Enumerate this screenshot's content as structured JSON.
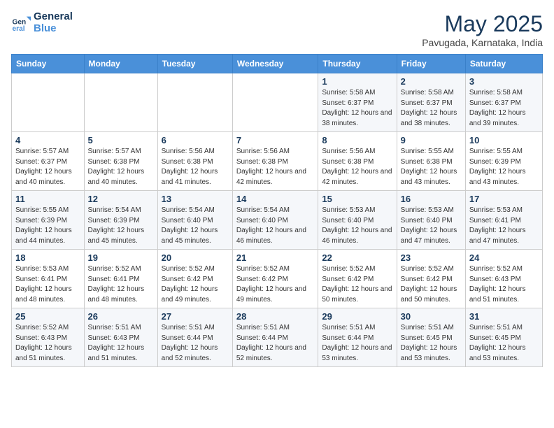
{
  "header": {
    "logo_line1": "General",
    "logo_line2": "Blue",
    "month": "May 2025",
    "location": "Pavugada, Karnataka, India"
  },
  "days_of_week": [
    "Sunday",
    "Monday",
    "Tuesday",
    "Wednesday",
    "Thursday",
    "Friday",
    "Saturday"
  ],
  "weeks": [
    [
      {
        "day": "",
        "info": ""
      },
      {
        "day": "",
        "info": ""
      },
      {
        "day": "",
        "info": ""
      },
      {
        "day": "",
        "info": ""
      },
      {
        "day": "1",
        "info": "Sunrise: 5:58 AM\nSunset: 6:37 PM\nDaylight: 12 hours\nand 38 minutes."
      },
      {
        "day": "2",
        "info": "Sunrise: 5:58 AM\nSunset: 6:37 PM\nDaylight: 12 hours\nand 38 minutes."
      },
      {
        "day": "3",
        "info": "Sunrise: 5:58 AM\nSunset: 6:37 PM\nDaylight: 12 hours\nand 39 minutes."
      }
    ],
    [
      {
        "day": "4",
        "info": "Sunrise: 5:57 AM\nSunset: 6:37 PM\nDaylight: 12 hours\nand 40 minutes."
      },
      {
        "day": "5",
        "info": "Sunrise: 5:57 AM\nSunset: 6:38 PM\nDaylight: 12 hours\nand 40 minutes."
      },
      {
        "day": "6",
        "info": "Sunrise: 5:56 AM\nSunset: 6:38 PM\nDaylight: 12 hours\nand 41 minutes."
      },
      {
        "day": "7",
        "info": "Sunrise: 5:56 AM\nSunset: 6:38 PM\nDaylight: 12 hours\nand 42 minutes."
      },
      {
        "day": "8",
        "info": "Sunrise: 5:56 AM\nSunset: 6:38 PM\nDaylight: 12 hours\nand 42 minutes."
      },
      {
        "day": "9",
        "info": "Sunrise: 5:55 AM\nSunset: 6:38 PM\nDaylight: 12 hours\nand 43 minutes."
      },
      {
        "day": "10",
        "info": "Sunrise: 5:55 AM\nSunset: 6:39 PM\nDaylight: 12 hours\nand 43 minutes."
      }
    ],
    [
      {
        "day": "11",
        "info": "Sunrise: 5:55 AM\nSunset: 6:39 PM\nDaylight: 12 hours\nand 44 minutes."
      },
      {
        "day": "12",
        "info": "Sunrise: 5:54 AM\nSunset: 6:39 PM\nDaylight: 12 hours\nand 45 minutes."
      },
      {
        "day": "13",
        "info": "Sunrise: 5:54 AM\nSunset: 6:40 PM\nDaylight: 12 hours\nand 45 minutes."
      },
      {
        "day": "14",
        "info": "Sunrise: 5:54 AM\nSunset: 6:40 PM\nDaylight: 12 hours\nand 46 minutes."
      },
      {
        "day": "15",
        "info": "Sunrise: 5:53 AM\nSunset: 6:40 PM\nDaylight: 12 hours\nand 46 minutes."
      },
      {
        "day": "16",
        "info": "Sunrise: 5:53 AM\nSunset: 6:40 PM\nDaylight: 12 hours\nand 47 minutes."
      },
      {
        "day": "17",
        "info": "Sunrise: 5:53 AM\nSunset: 6:41 PM\nDaylight: 12 hours\nand 47 minutes."
      }
    ],
    [
      {
        "day": "18",
        "info": "Sunrise: 5:53 AM\nSunset: 6:41 PM\nDaylight: 12 hours\nand 48 minutes."
      },
      {
        "day": "19",
        "info": "Sunrise: 5:52 AM\nSunset: 6:41 PM\nDaylight: 12 hours\nand 48 minutes."
      },
      {
        "day": "20",
        "info": "Sunrise: 5:52 AM\nSunset: 6:42 PM\nDaylight: 12 hours\nand 49 minutes."
      },
      {
        "day": "21",
        "info": "Sunrise: 5:52 AM\nSunset: 6:42 PM\nDaylight: 12 hours\nand 49 minutes."
      },
      {
        "day": "22",
        "info": "Sunrise: 5:52 AM\nSunset: 6:42 PM\nDaylight: 12 hours\nand 50 minutes."
      },
      {
        "day": "23",
        "info": "Sunrise: 5:52 AM\nSunset: 6:42 PM\nDaylight: 12 hours\nand 50 minutes."
      },
      {
        "day": "24",
        "info": "Sunrise: 5:52 AM\nSunset: 6:43 PM\nDaylight: 12 hours\nand 51 minutes."
      }
    ],
    [
      {
        "day": "25",
        "info": "Sunrise: 5:52 AM\nSunset: 6:43 PM\nDaylight: 12 hours\nand 51 minutes."
      },
      {
        "day": "26",
        "info": "Sunrise: 5:51 AM\nSunset: 6:43 PM\nDaylight: 12 hours\nand 51 minutes."
      },
      {
        "day": "27",
        "info": "Sunrise: 5:51 AM\nSunset: 6:44 PM\nDaylight: 12 hours\nand 52 minutes."
      },
      {
        "day": "28",
        "info": "Sunrise: 5:51 AM\nSunset: 6:44 PM\nDaylight: 12 hours\nand 52 minutes."
      },
      {
        "day": "29",
        "info": "Sunrise: 5:51 AM\nSunset: 6:44 PM\nDaylight: 12 hours\nand 53 minutes."
      },
      {
        "day": "30",
        "info": "Sunrise: 5:51 AM\nSunset: 6:45 PM\nDaylight: 12 hours\nand 53 minutes."
      },
      {
        "day": "31",
        "info": "Sunrise: 5:51 AM\nSunset: 6:45 PM\nDaylight: 12 hours\nand 53 minutes."
      }
    ]
  ]
}
